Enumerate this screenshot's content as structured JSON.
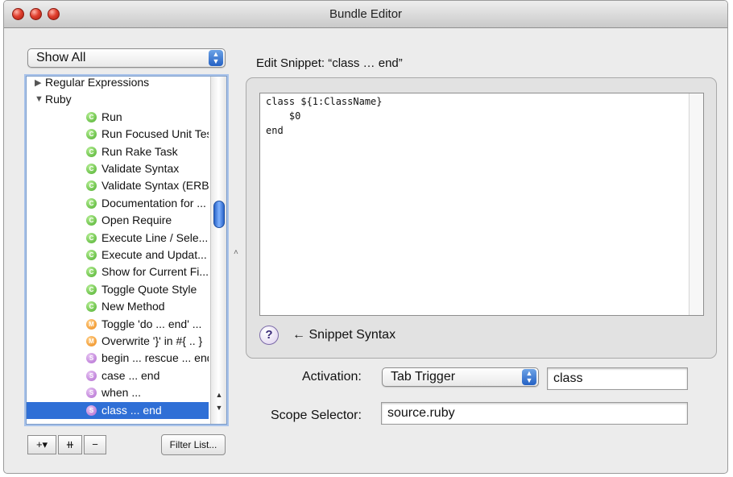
{
  "window": {
    "title": "Bundle Editor"
  },
  "filter_popup": {
    "value": "Show All"
  },
  "tree": {
    "rows": [
      {
        "label": "Regular Expressions",
        "kind": "group",
        "expanded": false
      },
      {
        "label": "Ruby",
        "kind": "group",
        "expanded": true
      },
      {
        "label": "Run",
        "kind": "command",
        "badge": "C"
      },
      {
        "label": "Run Focused Unit Test",
        "kind": "command",
        "badge": "C"
      },
      {
        "label": "Run Rake Task",
        "kind": "command",
        "badge": "C"
      },
      {
        "label": "Validate Syntax",
        "kind": "command",
        "badge": "C"
      },
      {
        "label": "Validate Syntax (ERB)",
        "kind": "command",
        "badge": "C"
      },
      {
        "label": "Documentation for ...",
        "kind": "command",
        "badge": "C"
      },
      {
        "label": "Open Require",
        "kind": "command",
        "badge": "C"
      },
      {
        "label": "Execute Line / Sele...",
        "kind": "command",
        "badge": "C"
      },
      {
        "label": "Execute and Updat...",
        "kind": "command",
        "badge": "C"
      },
      {
        "label": "Show for Current Fi...",
        "kind": "command",
        "badge": "C"
      },
      {
        "label": "Toggle Quote Style",
        "kind": "command",
        "badge": "C"
      },
      {
        "label": "New Method",
        "kind": "command",
        "badge": "C"
      },
      {
        "label": "Toggle 'do ... end' ...",
        "kind": "macro",
        "badge": "M"
      },
      {
        "label": "Overwrite '}' in #{ .. }",
        "kind": "macro",
        "badge": "M"
      },
      {
        "label": "begin ... rescue ... end",
        "kind": "snippet",
        "badge": "S"
      },
      {
        "label": "case ... end",
        "kind": "snippet",
        "badge": "S"
      },
      {
        "label": "when ...",
        "kind": "snippet",
        "badge": "S"
      },
      {
        "label": "class ... end",
        "kind": "snippet",
        "badge": "S",
        "selected": true
      }
    ]
  },
  "bottom_bar": {
    "add_label": "+▾",
    "add_folder_label": "⧺",
    "remove_label": "−",
    "filter_label": "Filter List..."
  },
  "edit": {
    "heading": "Edit Snippet: “class … end”",
    "code_lines": [
      "class ${1:ClassName}",
      "    $0",
      "end"
    ],
    "help_label": "?",
    "syntax_link": "← Snippet Syntax"
  },
  "activation": {
    "label": "Activation:",
    "mode": "Tab Trigger",
    "trigger": "class"
  },
  "scope": {
    "label": "Scope Selector:",
    "value": "source.ruby"
  },
  "colors": {
    "selection": "#2f6fd6",
    "command_badge": "#4dae2c",
    "macro_badge": "#ee8a18",
    "snippet_badge": "#b16ad0"
  }
}
